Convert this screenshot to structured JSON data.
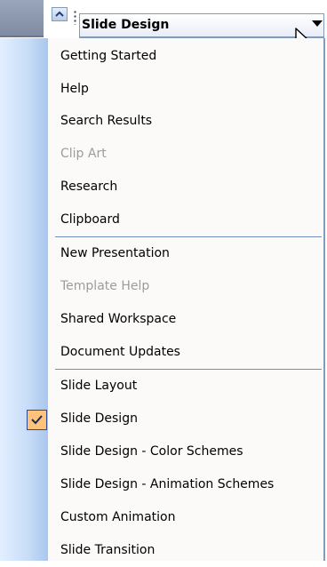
{
  "header": {
    "title": "Slide Design",
    "icons": [
      "scroll-up-arrow-icon",
      "grip-icon",
      "dropdown-arrow-icon",
      "mouse-cursor-icon"
    ]
  },
  "menu": {
    "checked_item": "Slide Design",
    "check_color": "#ffc27a",
    "items": [
      {
        "label": "Getting Started",
        "disabled": false
      },
      {
        "label": "Help",
        "disabled": false
      },
      {
        "label": "Search Results",
        "disabled": false
      },
      {
        "label": "Clip Art",
        "disabled": true
      },
      {
        "label": "Research",
        "disabled": false
      },
      {
        "label": "Clipboard",
        "disabled": false
      },
      {
        "label": "New Presentation",
        "disabled": false
      },
      {
        "label": "Template Help",
        "disabled": true
      },
      {
        "label": "Shared Workspace",
        "disabled": false
      },
      {
        "label": "Document Updates",
        "disabled": false
      },
      {
        "label": "Slide Layout",
        "disabled": false
      },
      {
        "label": "Slide Design",
        "disabled": false
      },
      {
        "label": "Slide Design - Color Schemes",
        "disabled": false
      },
      {
        "label": "Slide Design - Animation Schemes",
        "disabled": false
      },
      {
        "label": "Custom Animation",
        "disabled": false
      },
      {
        "label": "Slide Transition",
        "disabled": false
      }
    ]
  }
}
